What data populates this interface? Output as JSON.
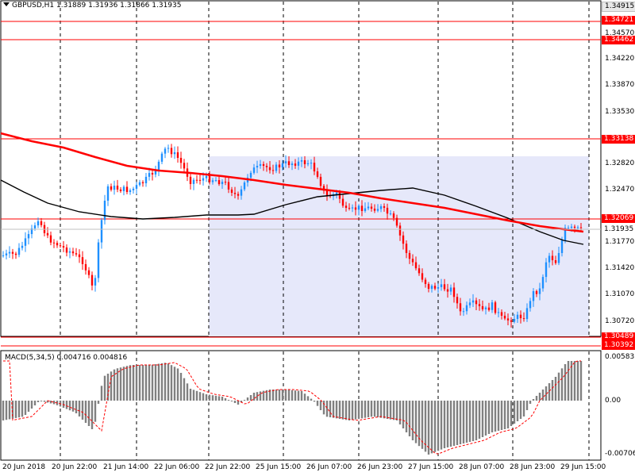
{
  "header": {
    "symbol_text": "GBPUSD,H1  1.31889 1.31936 1.31866 1.31935"
  },
  "macd": {
    "label": "MACD(5,34,5) 0.004716 0.004816",
    "axis_labels": [
      "0.005831",
      "0.00",
      "-0.007068"
    ]
  },
  "price_axis": {
    "labels": [
      "1.34570",
      "1.34220",
      "1.33870",
      "1.33530",
      "1.32820",
      "1.32470",
      "1.31770",
      "1.31420",
      "1.31070",
      "1.30720"
    ]
  },
  "level_tags": [
    {
      "price": "1.34915",
      "style": "grey"
    },
    {
      "price": "1.34721",
      "style": "red"
    },
    {
      "price": "1.34462",
      "style": "red"
    },
    {
      "price": "1.33138",
      "style": "red"
    },
    {
      "price": "1.32069",
      "style": "red"
    },
    {
      "price": "1.30489",
      "style": "red"
    },
    {
      "price": "1.30392",
      "style": "red"
    }
  ],
  "current_price": "1.31935",
  "time_axis": {
    "labels": [
      "20 Jun 2018",
      "20 Jun 22:00",
      "21 Jun 14:00",
      "22 Jun 06:00",
      "22 Jun 22:00",
      "25 Jun 15:00",
      "26 Jun 07:00",
      "26 Jun 23:00",
      "27 Jun 15:00",
      "28 Jun 07:00",
      "28 Jun 23:00",
      "29 Jun 15:00"
    ]
  },
  "colors": {
    "bull": "#1e90ff",
    "bear": "#ff0000",
    "ma_slow": "#ff0000",
    "ma_fast": "#000000",
    "zone": "#e6e8fa",
    "level_line": "#ff0000",
    "macd_hist": "#808080",
    "macd_signal": "#ff0000"
  }
}
